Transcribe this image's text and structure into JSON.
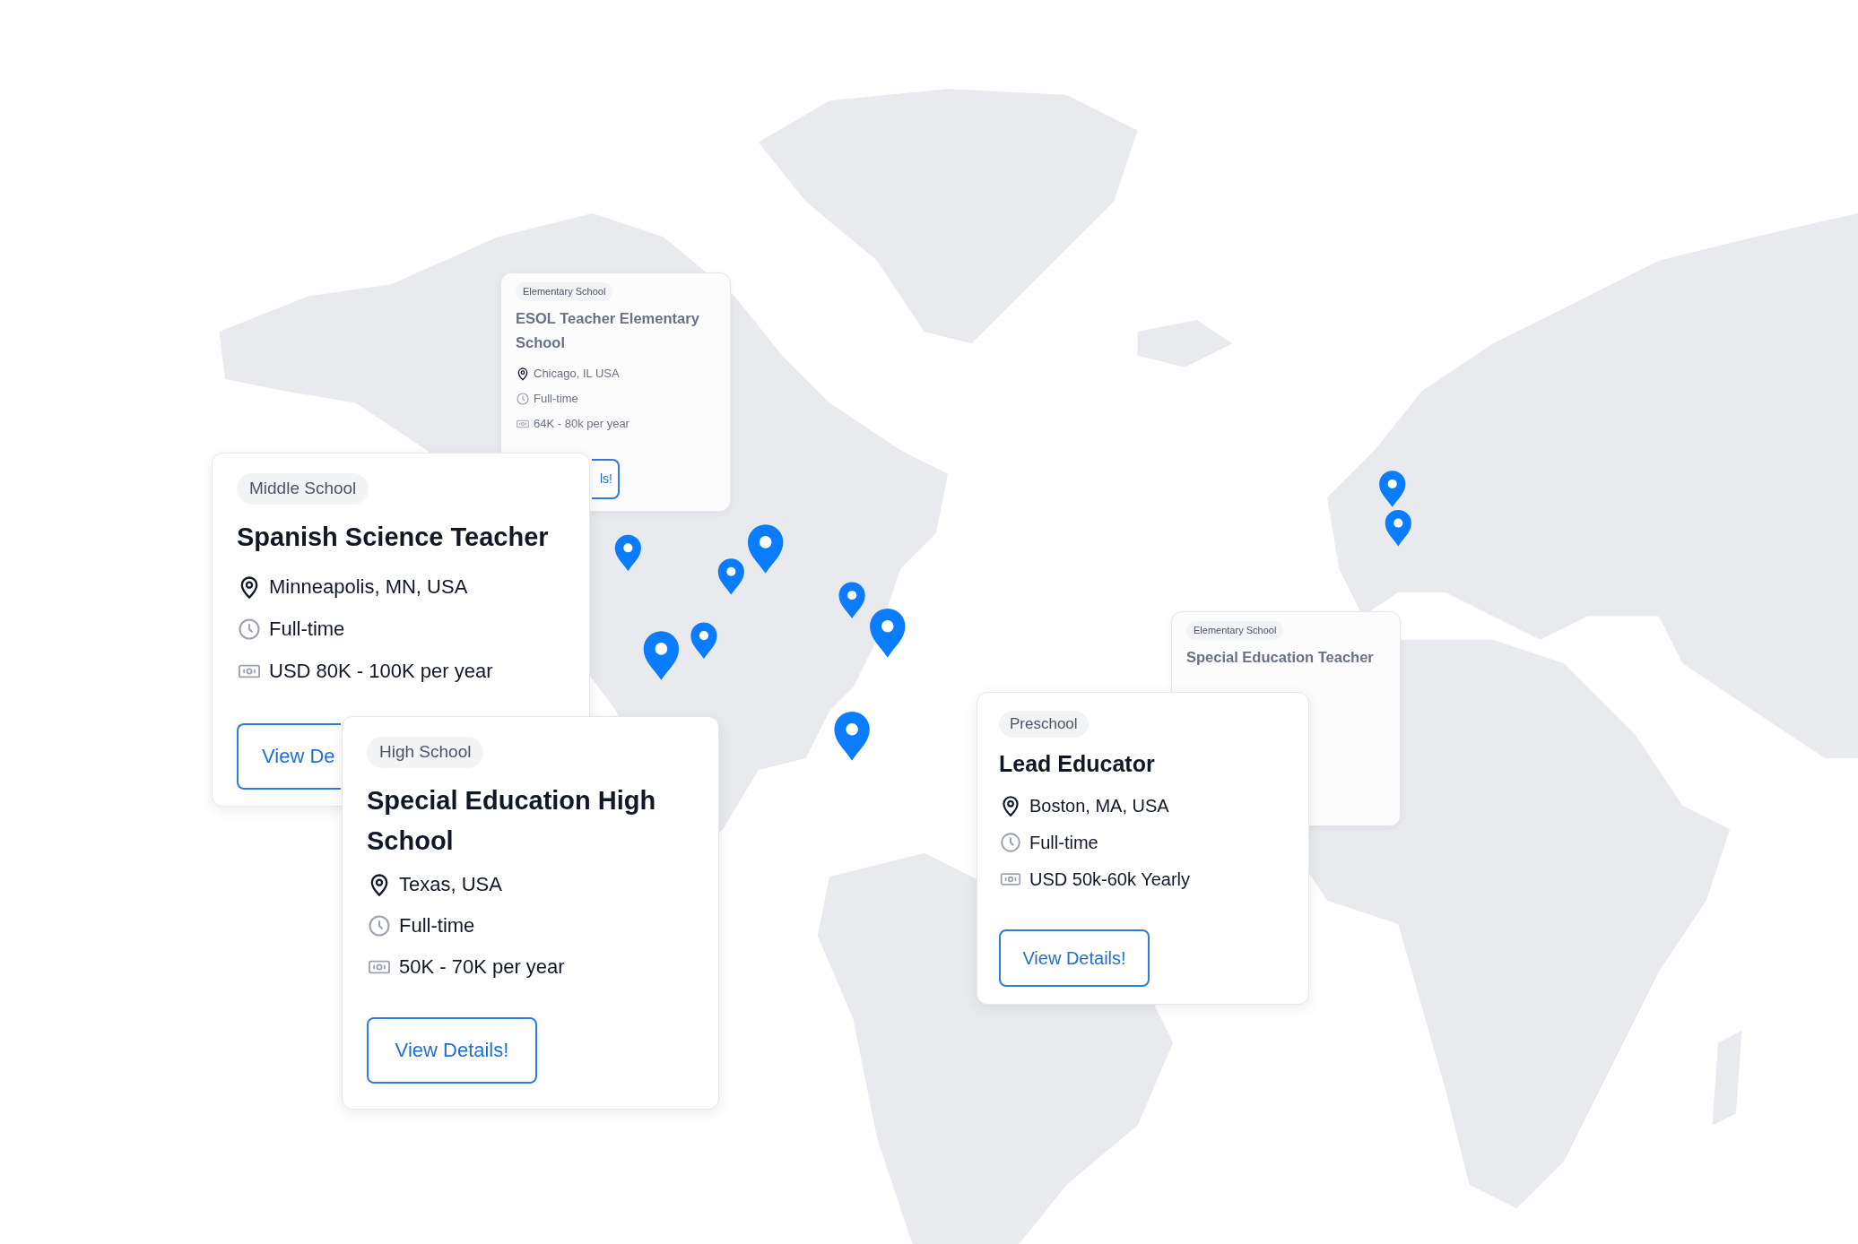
{
  "cards": [
    {
      "blurred": true,
      "badge": "Elementary School",
      "title": "ESOL Teacher Elementary School",
      "location": "Chicago, IL USA",
      "schedule": "Full-time",
      "salary": "64K - 80k per year",
      "button": "ls!"
    },
    {
      "blurred": true,
      "badge": "Elementary School",
      "title": "Special Education Teacher"
    },
    {
      "blurred": false,
      "badge": "Middle School",
      "title": "Spanish Science Teacher",
      "location": "Minneapolis, MN, USA",
      "schedule": "Full-time",
      "salary": "USD 80K - 100K per year",
      "button": "View De"
    },
    {
      "blurred": false,
      "badge": "High School",
      "title": "Special Education High School",
      "location": "Texas, USA",
      "schedule": "Full-time",
      "salary": "50K - 70K per year",
      "button": "View Details!"
    },
    {
      "blurred": false,
      "badge": "Preschool",
      "title": "Lead Educator",
      "location": "Boston, MA, USA",
      "schedule": "Full-time",
      "salary": "USD 50k-60k Yearly",
      "button": "View Details!"
    }
  ]
}
